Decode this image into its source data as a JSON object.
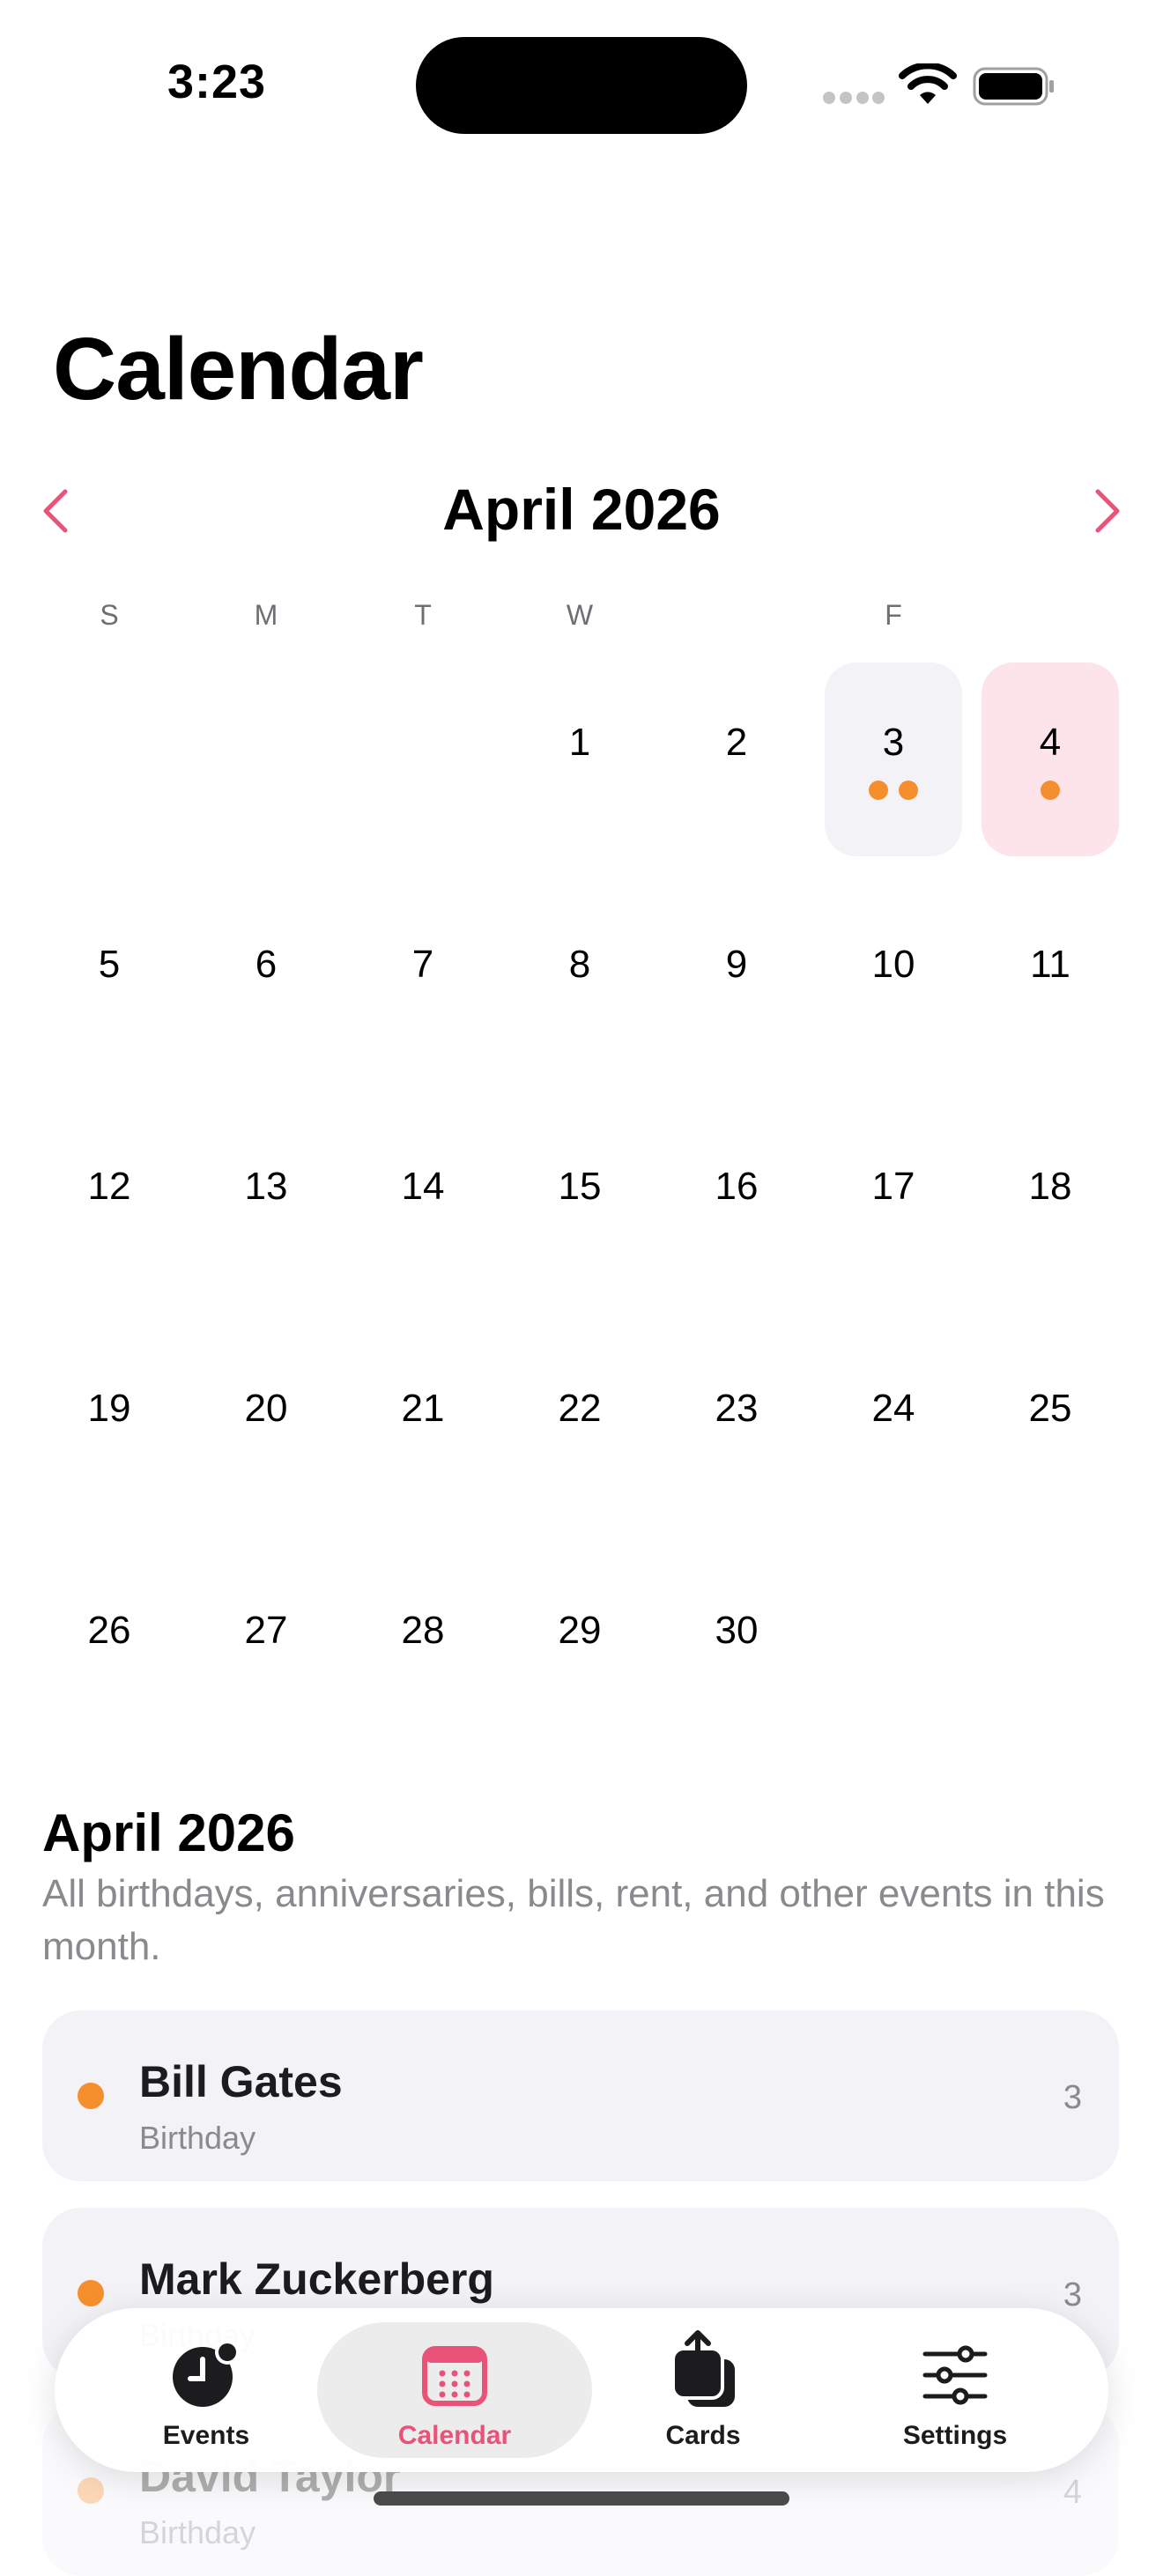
{
  "status_bar": {
    "time": "3:23",
    "icons": [
      "cellular-dots-icon",
      "wifi-icon",
      "battery-icon"
    ]
  },
  "page": {
    "title": "Calendar"
  },
  "calendar": {
    "month_label": "April 2026",
    "weekdays": [
      "S",
      "M",
      "T",
      "W",
      "",
      "F",
      ""
    ],
    "accent_color": "#e9537a",
    "event_dot_color": "#f58f2e",
    "weeks": [
      [
        {
          "day": ""
        },
        {
          "day": ""
        },
        {
          "day": ""
        },
        {
          "day": "1"
        },
        {
          "day": "2"
        },
        {
          "day": "3",
          "dots": 2,
          "highlight": "gray"
        },
        {
          "day": "4",
          "dots": 1,
          "highlight": "pink"
        }
      ],
      [
        {
          "day": "5"
        },
        {
          "day": "6"
        },
        {
          "day": "7"
        },
        {
          "day": "8"
        },
        {
          "day": "9"
        },
        {
          "day": "10"
        },
        {
          "day": "11"
        }
      ],
      [
        {
          "day": "12"
        },
        {
          "day": "13"
        },
        {
          "day": "14"
        },
        {
          "day": "15"
        },
        {
          "day": "16"
        },
        {
          "day": "17"
        },
        {
          "day": "18"
        }
      ],
      [
        {
          "day": "19"
        },
        {
          "day": "20"
        },
        {
          "day": "21"
        },
        {
          "day": "22"
        },
        {
          "day": "23"
        },
        {
          "day": "24"
        },
        {
          "day": "25"
        }
      ],
      [
        {
          "day": "26"
        },
        {
          "day": "27"
        },
        {
          "day": "28"
        },
        {
          "day": "29"
        },
        {
          "day": "30"
        },
        {
          "day": ""
        },
        {
          "day": ""
        }
      ]
    ]
  },
  "section": {
    "title": "April 2026",
    "description": "All birthdays, anniversaries, bills, rent, and other events in this month."
  },
  "events": [
    {
      "name": "Bill Gates",
      "type": "Birthday",
      "day": "3"
    },
    {
      "name": "Mark Zuckerberg",
      "type": "Birthday",
      "day": "3"
    },
    {
      "name": "David Taylor",
      "type": "Birthday",
      "day": "4"
    }
  ],
  "tab_bar": {
    "tabs": [
      {
        "label": "Events",
        "icon": "clock-badge-icon",
        "active": false
      },
      {
        "label": "Calendar",
        "icon": "calendar-icon",
        "active": true
      },
      {
        "label": "Cards",
        "icon": "share-cards-icon",
        "active": false
      },
      {
        "label": "Settings",
        "icon": "sliders-icon",
        "active": false
      }
    ]
  }
}
